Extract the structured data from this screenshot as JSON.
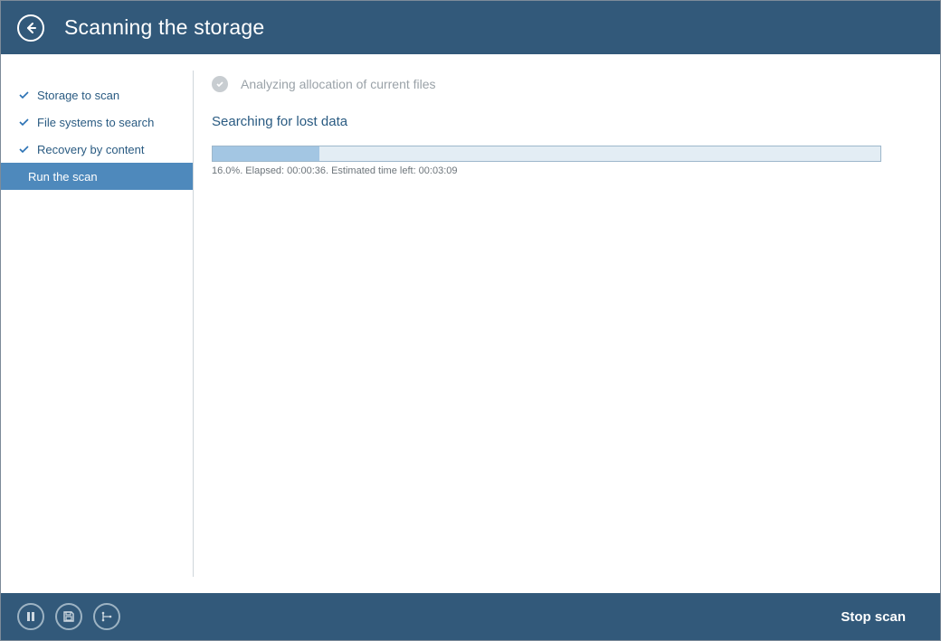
{
  "header": {
    "title": "Scanning the storage"
  },
  "sidebar": {
    "items": [
      {
        "label": "Storage to scan",
        "done": true,
        "selected": false
      },
      {
        "label": "File systems to search",
        "done": true,
        "selected": false
      },
      {
        "label": "Recovery by content",
        "done": true,
        "selected": false
      },
      {
        "label": "Run the scan",
        "done": false,
        "selected": true
      }
    ]
  },
  "main": {
    "completed_step": "Analyzing allocation of current files",
    "current_step": "Searching for lost data",
    "progress": {
      "percent": 16.0,
      "elapsed": "00:00:36",
      "estimated_left": "00:03:09",
      "status_text": "16.0%. Elapsed: 00:00:36. Estimated time left: 00:03:09"
    }
  },
  "footer": {
    "stop_label": "Stop scan"
  }
}
